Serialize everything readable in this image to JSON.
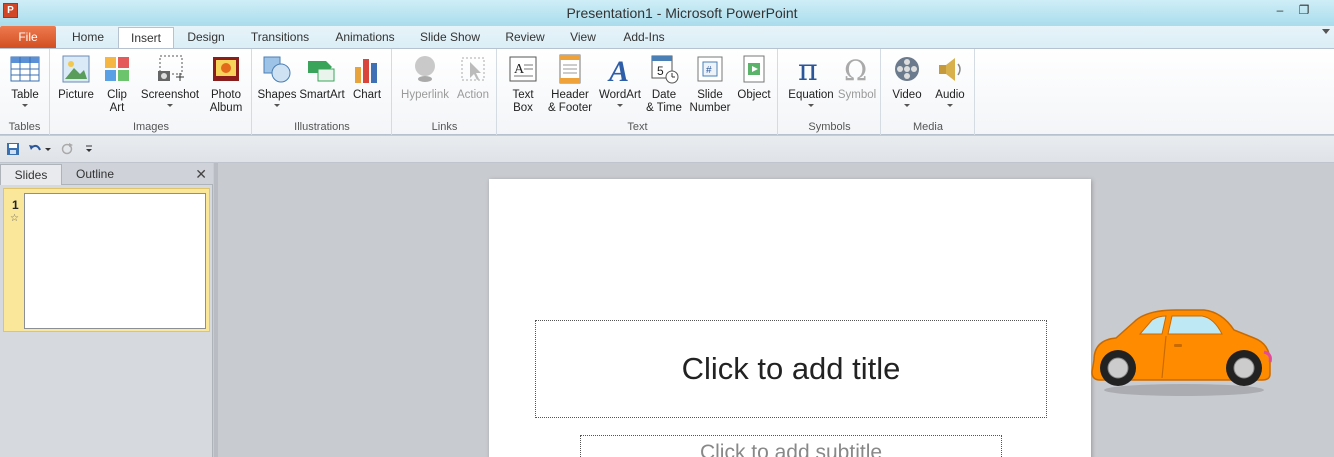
{
  "window": {
    "title": "Presentation1 - Microsoft PowerPoint",
    "app_icon_letter": "P",
    "minimize": "–",
    "restore": "❐"
  },
  "tabs": [
    {
      "label": "File"
    },
    {
      "label": "Home"
    },
    {
      "label": "Insert"
    },
    {
      "label": "Design"
    },
    {
      "label": "Transitions"
    },
    {
      "label": "Animations"
    },
    {
      "label": "Slide Show"
    },
    {
      "label": "Review"
    },
    {
      "label": "View"
    },
    {
      "label": "Add-Ins"
    }
  ],
  "ribbon": {
    "groups": {
      "tables": "Tables",
      "images": "Images",
      "illustrations": "Illustrations",
      "links": "Links",
      "text": "Text",
      "symbols": "Symbols",
      "media": "Media"
    },
    "buttons": {
      "table": "Table",
      "picture": "Picture",
      "clip_art_1": "Clip",
      "clip_art_2": "Art",
      "screenshot": "Screenshot",
      "photo_album_1": "Photo",
      "photo_album_2": "Album",
      "shapes": "Shapes",
      "smartart": "SmartArt",
      "chart": "Chart",
      "hyperlink": "Hyperlink",
      "action": "Action",
      "text_box_1": "Text",
      "text_box_2": "Box",
      "header_footer_1": "Header",
      "header_footer_2": "& Footer",
      "wordart": "WordArt",
      "date_time_1": "Date",
      "date_time_2": "& Time",
      "slide_number_1": "Slide",
      "slide_number_2": "Number",
      "object": "Object",
      "equation": "Equation",
      "symbol": "Symbol",
      "video": "Video",
      "audio": "Audio"
    }
  },
  "panel": {
    "tabs": [
      "Slides",
      "Outline"
    ],
    "close": "✕",
    "slide_number": "1",
    "star": "☆"
  },
  "slide": {
    "title_placeholder": "Click to add title",
    "subtitle_placeholder": "Click to add subtitle"
  },
  "colors": {
    "file_tab": "#d24f21",
    "car_body": "#ff8c00",
    "ribbon_accent": "#2b579a"
  }
}
